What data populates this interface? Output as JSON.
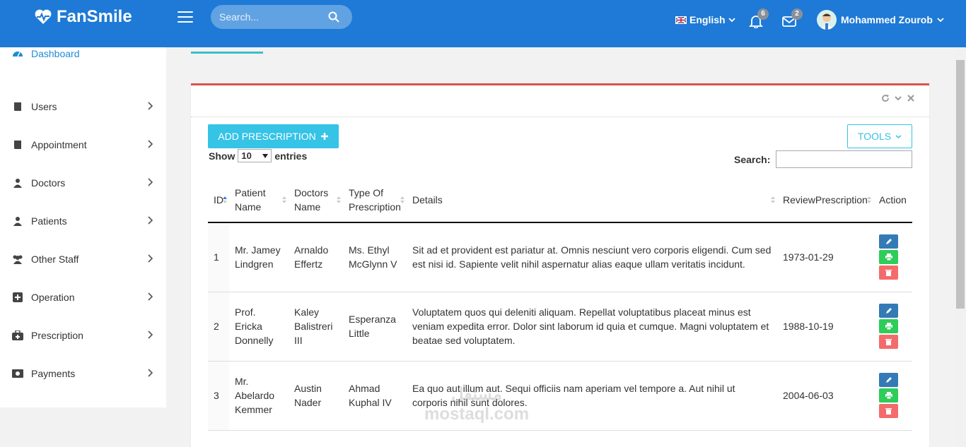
{
  "topbar": {
    "brand": "FanSmile",
    "search_placeholder": "Search...",
    "language": "English",
    "notifications_count": "6",
    "messages_count": "2",
    "user_name": "Mohammed Zourob"
  },
  "sidebar": {
    "items": [
      {
        "label": "Dashboard"
      },
      {
        "label": "Users"
      },
      {
        "label": "Appointment"
      },
      {
        "label": "Doctors"
      },
      {
        "label": "Patients"
      },
      {
        "label": "Other Staff"
      },
      {
        "label": "Operation"
      },
      {
        "label": "Prescription"
      },
      {
        "label": "Payments"
      }
    ]
  },
  "main": {
    "add_button": "ADD PRESCRIPTION",
    "tools_button": "TOOLS",
    "show_label": "Show",
    "entries_value": "10",
    "entries_label": "entries",
    "search_label": "Search:"
  },
  "table": {
    "headers": [
      "ID",
      "Patient Name",
      "Doctors Name",
      "Type Of Prescription",
      "Details",
      "ReviewPrescription",
      "Action"
    ],
    "rows": [
      {
        "id": "1",
        "patient": "Mr. Jamey Lindgren",
        "doctor": "Arnaldo Effertz",
        "type": "Ms. Ethyl McGlynn V",
        "details": "Sit ad et provident est pariatur at. Omnis nesciunt vero corporis eligendi. Cum sed est nisi id. Sapiente velit nihil aspernatur alias eaque ullam veritatis incidunt.",
        "review": "1973-01-29"
      },
      {
        "id": "2",
        "patient": "Prof. Ericka Donnelly",
        "doctor": "Kaley Balistreri III",
        "type": "Esperanza Little",
        "details": "Voluptatem quos qui deleniti aliquam. Repellat voluptatibus placeat minus est veniam expedita error. Dolor sint laborum id quia et cumque. Magni voluptatem et beatae sed voluptatem.",
        "review": "1988-10-19"
      },
      {
        "id": "3",
        "patient": "Mr. Abelardo Kemmer",
        "doctor": "Austin Nader",
        "type": "Ahmad Kuphal IV",
        "details": "Ea quo aut illum aut. Sequi officiis nam aperiam vel tempore a. Aut nihil ut corporis nihil sunt dolores.",
        "review": "2004-06-03"
      }
    ]
  },
  "watermark": {
    "line1": "مستقل",
    "line2": "mostaql.com"
  },
  "colors": {
    "topbar": "#1e7ad6",
    "accent": "#35c3e6",
    "card_border": "#d9534f"
  }
}
